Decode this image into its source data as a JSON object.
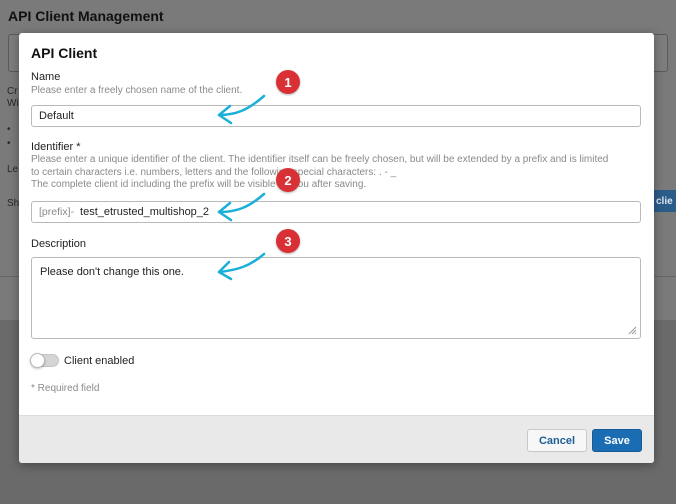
{
  "background": {
    "title": "API Client Management",
    "text_line1": "Cr",
    "text_line2": "Wi",
    "bullet1": "•",
    "bullet2": "•",
    "text_le": "Le",
    "text_sh": "Sh",
    "button_partial": "clie"
  },
  "modal": {
    "title": "API Client",
    "name": {
      "label": "Name",
      "hint": "Please enter a freely chosen name of the client.",
      "value": "Default"
    },
    "identifier": {
      "label": "Identifier *",
      "hint_line1": "Please enter a unique identifier of the client. The identifier itself can be freely chosen, but will be extended by a prefix and is limited",
      "hint_line2": "to certain characters i.e. numbers, letters and the following special characters: . - _",
      "hint_line3": "The complete client id including the prefix will be visible for you after saving.",
      "prefix": "[prefix]-",
      "value": "test_etrusted_multishop_2"
    },
    "description": {
      "label": "Description",
      "value": "Please don't change this one."
    },
    "toggle": {
      "label": "Client enabled",
      "enabled": false
    },
    "required_note": "* Required field",
    "footer": {
      "cancel_label": "Cancel",
      "save_label": "Save"
    }
  },
  "annotations": {
    "badge1": "1",
    "badge2": "2",
    "badge3": "3",
    "badge_color": "#d93035",
    "arrow_color": "#1ab0d8"
  }
}
